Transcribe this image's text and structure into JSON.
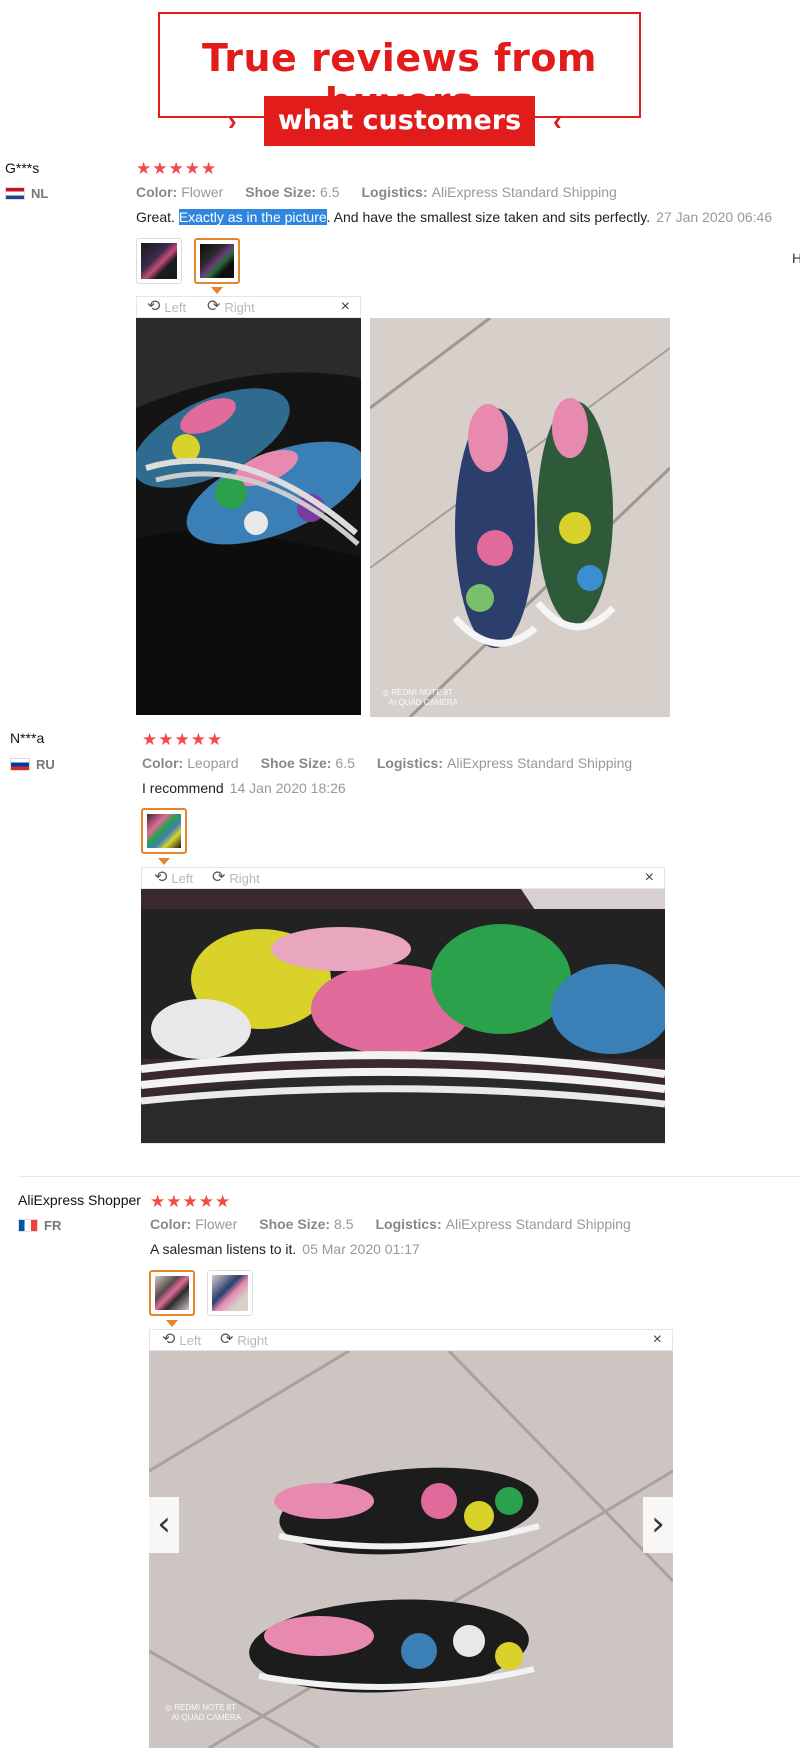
{
  "banner": {
    "title": "True reviews from buyers",
    "subtitle": "what customers say",
    "accent_color": "#e21b1b"
  },
  "viewer": {
    "left_label": "Left",
    "right_label": "Right",
    "rotate_left_icon": "rotate-left-icon",
    "rotate_right_icon": "rotate-right-icon",
    "close_icon": "close-icon",
    "close_glyph": "×",
    "prev_glyph": "‹",
    "next_glyph": "›"
  },
  "labels": {
    "color": "Color:",
    "size": "Shoe Size:",
    "logistics": "Logistics:"
  },
  "reviews": [
    {
      "user": "G***s",
      "country": "NL",
      "stars": "★★★★★",
      "color": "Flower",
      "size": "6.5",
      "logistics": "AliExpress Standard Shipping",
      "text_before": "Great. ",
      "text_highlight": "Exactly as in the picture",
      "text_after": ". And have the smallest size taken and sits perfectly.",
      "date": "27 Jan 2020 06:46",
      "watermark": "REDMI NOTE 8T\nAI QUAD CAMERA"
    },
    {
      "user": "N***a",
      "country": "RU",
      "stars": "★★★★★",
      "color": "Leopard",
      "size": "6.5",
      "logistics": "AliExpress Standard Shipping",
      "text": "I recommend",
      "date": "14 Jan 2020 18:26"
    },
    {
      "user": "AliExpress Shopper",
      "country": "FR",
      "stars": "★★★★★",
      "color": "Flower",
      "size": "8.5",
      "logistics": "AliExpress Standard Shipping",
      "text": "A salesman listens to it.",
      "date": "05 Mar 2020 01:17",
      "watermark": "REDMI NOTE 8T\nAI QUAD CAMERA"
    }
  ],
  "edge_stub": "H"
}
